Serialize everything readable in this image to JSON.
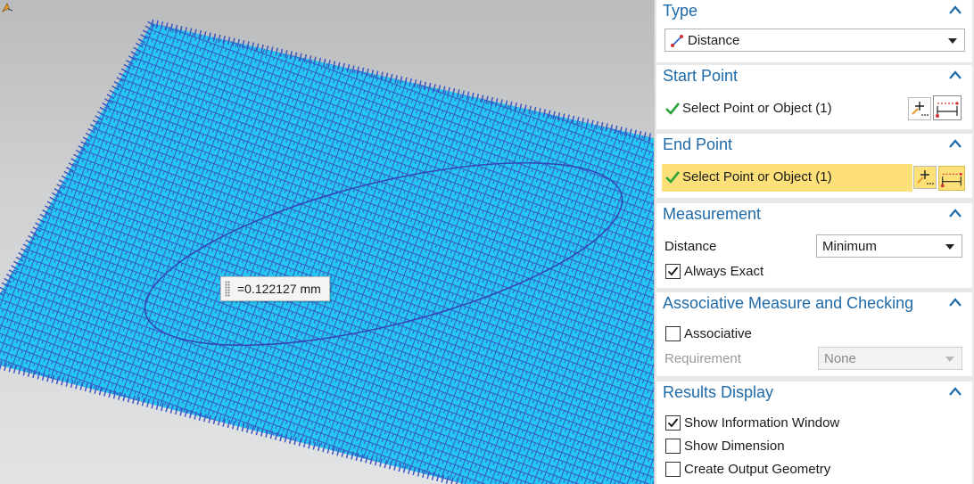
{
  "viewport": {
    "measurement_label": "=0.122127 mm"
  },
  "dialog": {
    "type_section": {
      "title": "Type",
      "selected": "Distance",
      "icon": "distance-type-icon"
    },
    "start_point": {
      "title": "Start Point",
      "select_label": "Select Point or Object (1)"
    },
    "end_point": {
      "title": "End Point",
      "select_label": "Select Point or Object (1)"
    },
    "measurement": {
      "title": "Measurement",
      "distance_label": "Distance",
      "distance_value": "Minimum",
      "always_exact_label": "Always Exact",
      "always_exact_checked": true
    },
    "associative": {
      "title": "Associative Measure and Checking",
      "associative_label": "Associative",
      "associative_checked": false,
      "requirement_label": "Requirement",
      "requirement_value": "None"
    },
    "results": {
      "title": "Results Display",
      "show_info_label": "Show Information Window",
      "show_info_checked": true,
      "show_dimension_label": "Show Dimension",
      "show_dimension_checked": false,
      "create_output_label": "Create Output Geometry",
      "create_output_checked": false
    }
  },
  "colors": {
    "mesh_fill": "#25c6f2",
    "mesh_lines": "#3a56c0",
    "section_title": "#1e6aa8",
    "highlight": "#fde178",
    "check_green": "#2aa43a"
  }
}
